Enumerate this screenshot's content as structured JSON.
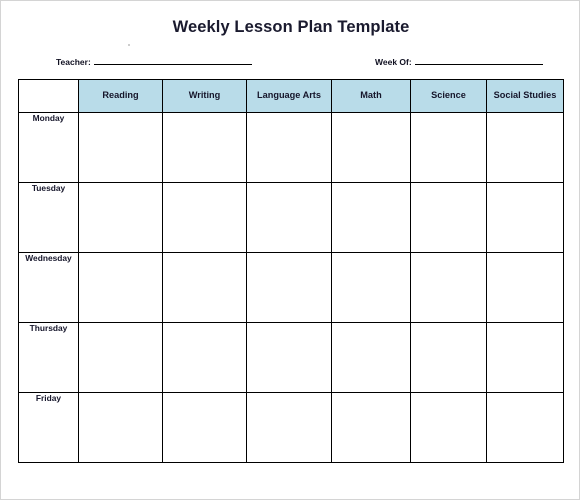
{
  "document": {
    "title": "Weekly Lesson Plan Template"
  },
  "fields": {
    "teacher": {
      "label": "Teacher:",
      "value": ""
    },
    "week_of": {
      "label": "Week Of:",
      "value": ""
    }
  },
  "table": {
    "corner_header": "",
    "column_headers": [
      "Reading",
      "Writing",
      "Language Arts",
      "Math",
      "Science",
      "Social Studies"
    ],
    "rows": [
      {
        "day": "Monday",
        "cells": [
          "",
          "",
          "",
          "",
          "",
          ""
        ]
      },
      {
        "day": "Tuesday",
        "cells": [
          "",
          "",
          "",
          "",
          "",
          ""
        ]
      },
      {
        "day": "Wednesday",
        "cells": [
          "",
          "",
          "",
          "",
          "",
          ""
        ]
      },
      {
        "day": "Thursday",
        "cells": [
          "",
          "",
          "",
          "",
          "",
          ""
        ]
      },
      {
        "day": "Friday",
        "cells": [
          "",
          "",
          "",
          "",
          "",
          ""
        ]
      }
    ]
  },
  "colors": {
    "header_fill": "#b9dce9",
    "grid_line": "#000000",
    "text": "#16162b",
    "page_border": "#d4d4d4"
  }
}
